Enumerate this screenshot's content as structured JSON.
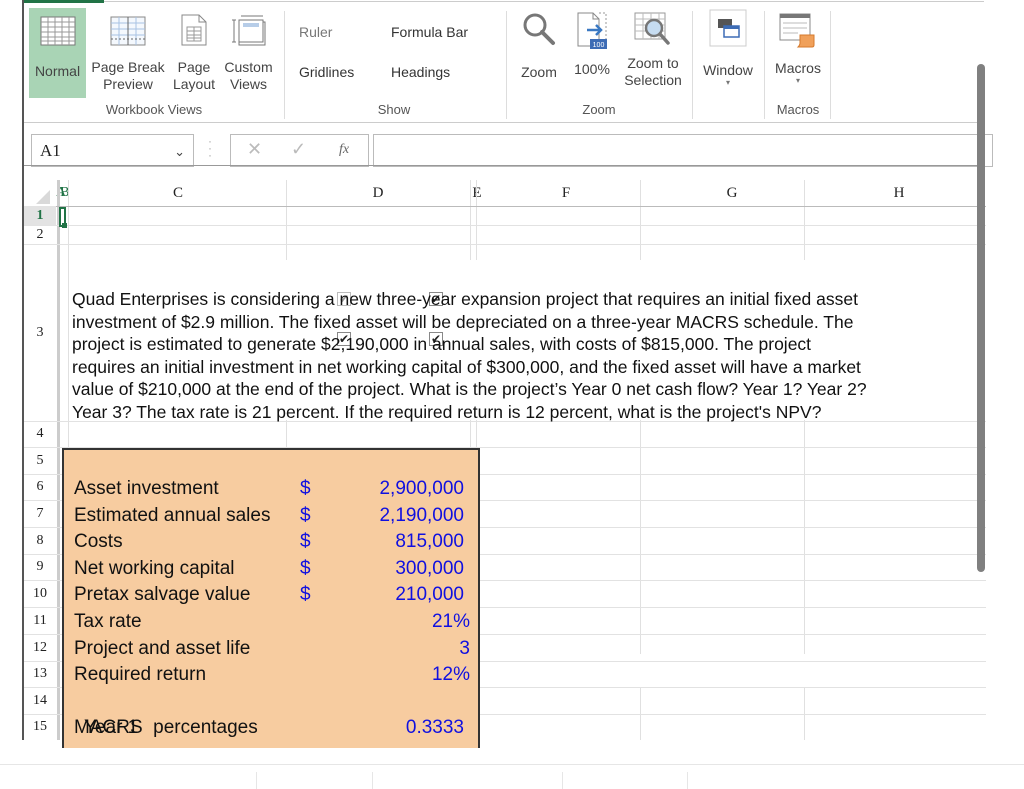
{
  "ribbon": {
    "workbook_views": {
      "group_label": "Workbook Views",
      "buttons": [
        {
          "id": "normal",
          "label": "Normal",
          "icon": "normal-view-icon",
          "active": true
        },
        {
          "id": "page-break-preview",
          "label_line1": "Page Break",
          "label_line2": "Preview",
          "icon": "page-break-preview-icon"
        },
        {
          "id": "page-layout",
          "label_line1": "Page",
          "label_line2": "Layout",
          "icon": "page-layout-icon"
        },
        {
          "id": "custom-views",
          "label_line1": "Custom",
          "label_line2": "Views",
          "icon": "custom-views-icon"
        }
      ]
    },
    "show": {
      "group_label": "Show",
      "checkboxes": [
        {
          "label": "Ruler",
          "checked": true,
          "disabled": true
        },
        {
          "label": "Formula Bar",
          "checked": true
        },
        {
          "label": "Gridlines",
          "checked": true
        },
        {
          "label": "Headings",
          "checked": true
        }
      ],
      "check_glyph": "✔"
    },
    "zoom": {
      "group_label": "Zoom",
      "buttons": [
        {
          "label": "Zoom",
          "icon": "magnifier-icon"
        },
        {
          "label": "100%",
          "icon": "zoom-100-icon",
          "badge": "100"
        },
        {
          "label_line1": "Zoom to",
          "label_line2": "Selection",
          "icon": "zoom-to-selection-icon"
        }
      ]
    },
    "window": {
      "label": "Window",
      "icon": "window-icon",
      "arrow": "▾"
    },
    "macros": {
      "group_label": "Macros",
      "label": "Macros",
      "icon": "macros-icon",
      "arrow": "▾"
    }
  },
  "formula_bar": {
    "name_box": "A1",
    "name_box_arrow": "⌄",
    "cancel_glyph": "✕",
    "enter_glyph": "✓",
    "fx_label": "fx",
    "formula_value": ""
  },
  "grid": {
    "columns": [
      "A",
      "B",
      "C",
      "D",
      "E",
      "F",
      "G",
      "H"
    ],
    "visible_column_headers": {
      "ab": "AB",
      "c": "C",
      "d": "D",
      "e": "E",
      "f": "F",
      "g": "G",
      "h": "H"
    },
    "rows": [
      "1",
      "2",
      "3",
      "4",
      "5",
      "6",
      "7",
      "8",
      "9",
      "10",
      "11",
      "12",
      "13",
      "14",
      "15"
    ],
    "selected_cell": "A1"
  },
  "problem_text": "Quad Enterprises is considering a new three-year expansion project that requires an initial fixed asset\ninvestment of $2.9 million. The fixed asset will be depreciated on a three-year MACRS schedule. The\nproject is estimated to generate $2,190,000 in annual sales, with costs of $815,000. The project\nrequires an initial investment in net working capital of $300,000, and the fixed asset will have a market\nvalue of $210,000 at the end of the project. What is the project’s Year 0 net cash flow? Year 1? Year 2?\nYear 3? The tax rate is 21 percent. If the required return is 12 percent, what is the project's NPV?",
  "inputs": [
    {
      "row": "6",
      "label": "Asset investment",
      "currency": "$",
      "value": "2,900,000"
    },
    {
      "row": "7",
      "label": "Estimated annual sales",
      "currency": "$",
      "value": "2,190,000"
    },
    {
      "row": "8",
      "label": "Costs",
      "currency": "$",
      "value": "815,000"
    },
    {
      "row": "9",
      "label": "Net working capital",
      "currency": "$",
      "value": "300,000"
    },
    {
      "row": "10",
      "label": "Pretax salvage value",
      "currency": "$",
      "value": "210,000"
    },
    {
      "row": "11",
      "label": "Tax rate",
      "currency": "",
      "value": "21%"
    },
    {
      "row": "12",
      "label": "Project and asset life",
      "currency": "",
      "value": "3"
    },
    {
      "row": "13",
      "label": "Required return",
      "currency": "",
      "value": "12%"
    },
    {
      "row": "14",
      "label": "MACRS  percentages",
      "currency": "",
      "value": ""
    },
    {
      "row": "15",
      "label": "Year 1",
      "currency": "",
      "value": "0.3333"
    }
  ],
  "colors": {
    "accent_green": "#217346",
    "normal_active_bg": "#a9d4b5",
    "input_box_bg": "#f7cca0",
    "input_value_blue": "#1010e0"
  }
}
